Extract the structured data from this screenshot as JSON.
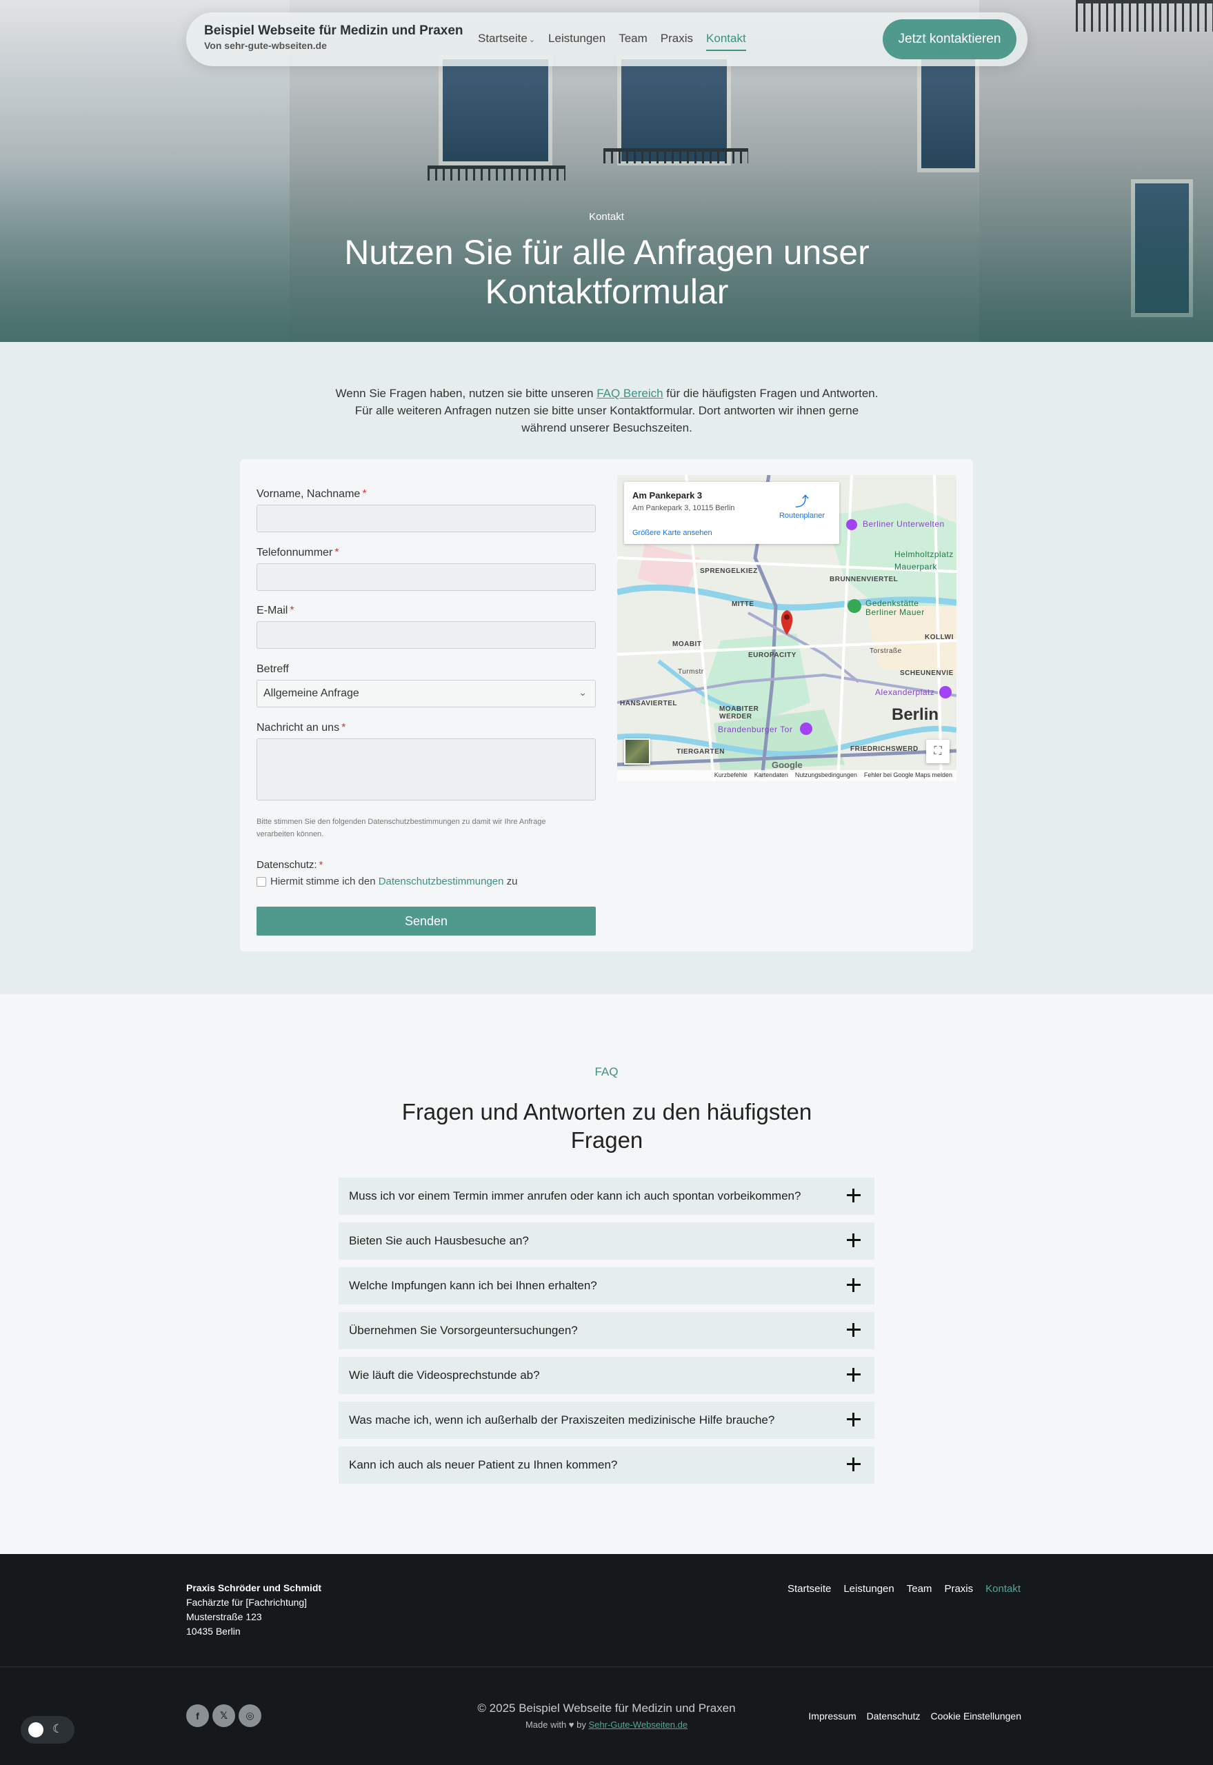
{
  "header": {
    "brand_title": "Beispiel Webseite für Medizin und Praxen",
    "brand_sub": "Von sehr-gute-wbseiten.de",
    "nav": [
      "Startseite",
      "Leistungen",
      "Team",
      "Praxis",
      "Kontakt"
    ],
    "active_nav": "Kontakt",
    "cta": "Jetzt kontaktieren"
  },
  "hero": {
    "kicker": "Kontakt",
    "title": "Nutzen Sie für alle Anfragen unser Kontaktformular"
  },
  "intro": {
    "before_link": "Wenn Sie Fragen haben, nutzen sie bitte unseren ",
    "link": "FAQ Bereich",
    "after_link": " für die häufigsten Fragen und Antworten. Für alle weiteren Anfragen nutzen sie bitte unser Kontaktformular. Dort antworten wir ihnen gerne während unserer Besuchszeiten."
  },
  "form": {
    "name_label": "Vorname, Nachname",
    "phone_label": "Telefonnummer",
    "email_label": "E-Mail",
    "subject_label": "Betreff",
    "subject_value": "Allgemeine Anfrage",
    "message_label": "Nachricht an uns",
    "required_mark": "*",
    "privacy_note": "Bitte stimmen Sie den folgenden Datenschutzbestimmungen zu damit wir Ihre Anfrage verarbeiten können.",
    "privacy_label": "Datenschutz:",
    "consent_before": "Hiermit stimme ich den ",
    "consent_link": "Datenschutzbestimmungen",
    "consent_after": " zu",
    "submit": "Senden"
  },
  "map": {
    "place_title": "Am Pankepark 3",
    "place_address": "Am Pankepark 3, 10115 Berlin",
    "route_label": "Routenplaner",
    "larger_map": "Größere Karte ansehen",
    "labels": {
      "mitte": "MITTE",
      "europacity": "EUROPACITY",
      "moabit": "MOABIT",
      "sprengelkiez": "SPRENGELKIEZ",
      "brunnenviertel": "BRUNNENVIERTEL",
      "moabiter_werder": "MOABITER WERDER",
      "tiergarten": "TIERGARTEN",
      "hansaviertel": "HANSAVIERTEL",
      "kollwi": "KOLLWI",
      "scheunenvie": "SCHEUNENVIE",
      "friedrichswerd": "FRIEDRICHSWERD",
      "berlin": "Berlin",
      "brandenburger_tor": "Brandenburger Tor",
      "alexanderplatz": "Alexanderplatz",
      "gedenkstaette": "Gedenkstätte Berliner Mauer",
      "helmholtzplatz": "Helmholtzplatz",
      "mauerpark": "Mauerpark",
      "unterwelten": "Berliner Unterwelten",
      "turmstr": "Turmstr",
      "torstrasse": "Torstraße"
    },
    "footer": [
      "Kurzbefehle",
      "Kartendaten",
      "Nutzungsbedingungen",
      "Fehler bei Google Maps melden"
    ],
    "google": "Google"
  },
  "faq": {
    "kicker": "FAQ",
    "title": "Fragen und Antworten zu den häufigsten Fragen",
    "items": [
      "Muss ich vor einem Termin immer anrufen oder kann ich auch spontan vorbeikommen?",
      "Bieten Sie auch Hausbesuche an?",
      "Welche Impfungen kann ich bei Ihnen erhalten?",
      "Übernehmen Sie Vorsorgeuntersuchungen?",
      "Wie läuft die Videosprechstunde ab?",
      "Was mache ich, wenn ich außerhalb der Praxiszeiten medizinische Hilfe brauche?",
      "Kann ich auch als neuer Patient zu Ihnen kommen?"
    ]
  },
  "footer": {
    "practice": "Praxis Schröder und Schmidt",
    "specialty": "Fachärzte für [Fachrichtung]",
    "street": "Musterstraße 123",
    "city": "10435 Berlin",
    "nav": [
      "Startseite",
      "Leistungen",
      "Team",
      "Praxis",
      "Kontakt"
    ],
    "copyright": "© 2025 Beispiel Webseite für Medizin und Praxen",
    "made_before": "Made with ♥ by ",
    "made_link": "Sehr-Gute-Webseiten.de",
    "legal": [
      "Impressum",
      "Datenschutz",
      "Cookie Einstellungen"
    ],
    "social_icons": [
      "facebook-icon",
      "x-icon",
      "instagram-icon"
    ]
  },
  "colors": {
    "accent": "#4f9a8c",
    "footer_bg": "#16191b",
    "faq_item_bg": "#e6eeed"
  }
}
